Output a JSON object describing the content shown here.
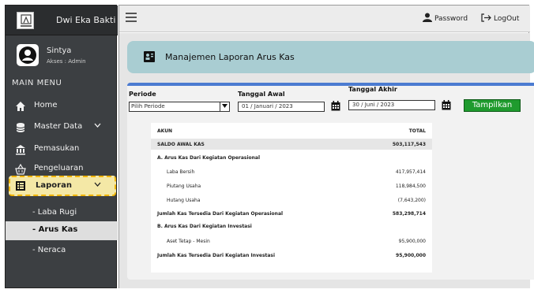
{
  "brand": {
    "name": "Dwi Eka Bakti"
  },
  "user": {
    "name": "Sintya",
    "role": "Akses : Admin"
  },
  "sidebar": {
    "section_title": "MAIN MENU",
    "items": [
      {
        "label": "Home",
        "icon": "home-icon"
      },
      {
        "label": "Master Data",
        "icon": "database-icon"
      },
      {
        "label": "Pemasukan",
        "icon": "bank-icon"
      },
      {
        "label": "Pengeluaran",
        "icon": "basket-icon"
      },
      {
        "label": "Laporan",
        "icon": "report-icon"
      }
    ],
    "submenu": [
      "- Laba Rugi",
      "- Arus Kas",
      "- Neraca"
    ]
  },
  "topbar": {
    "password_label": "Password",
    "logout_label": "LogOut"
  },
  "page": {
    "title": "Manajemen Laporan Arus Kas"
  },
  "filters": {
    "periode_label": "Periode",
    "periode_value": "Pilih Periode",
    "tanggal_awal_label": "Tanggal Awal",
    "tanggal_awal_value": "01 / Januari / 2023",
    "tanggal_akhir_label": "Tanggal Akhir",
    "tanggal_akhir_value": "30 / Juni / 2023",
    "button_label": "Tampilkan"
  },
  "table": {
    "headers": [
      "AKUN",
      "TOTAL"
    ],
    "rows": [
      {
        "akun": "SALDO AWAL KAS",
        "total": "503,117,543"
      },
      {
        "akun": "A. Arus Kas Dari Kegiatan Operasional",
        "total": ""
      },
      {
        "akun": "Laba Bersih",
        "total": "417,957,414"
      },
      {
        "akun": "Piutang Usaha",
        "total": "118,984,500"
      },
      {
        "akun": "Hutang Usaha",
        "total": "(7,643,200)"
      },
      {
        "akun": "Jumlah Kas Tersedia Dari Kegiatan Operasional",
        "total": "583,298,714"
      },
      {
        "akun": "B. Arus Kas Dari Kegiatan Investasi",
        "total": ""
      },
      {
        "akun": "Aset Tetap - Mesin",
        "total": "95,900,000"
      },
      {
        "akun": "Jumlah Kas Tersedia Dari Kegiatan Investasi",
        "total": "95,900,000"
      }
    ]
  },
  "colors": {
    "sidebar_bg": "#3c3f42",
    "active_menu_bg": "#f4e8a6",
    "active_menu_border": "#f0b400",
    "header_box_bg": "#a9cdd2",
    "panel_accent": "#4b7bd1",
    "button_bg": "#1f9b2e"
  }
}
